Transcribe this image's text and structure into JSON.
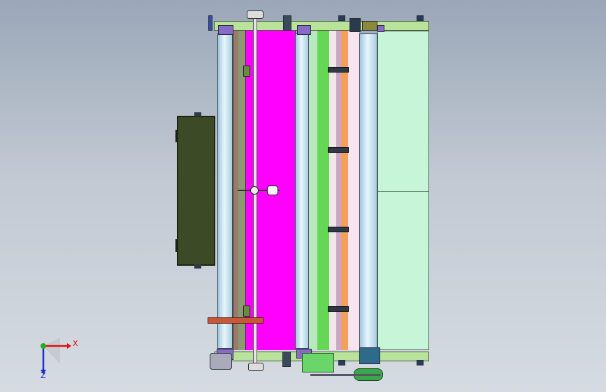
{
  "triad": {
    "x_label": "X",
    "z_label": "Z"
  },
  "colors": {
    "background_top": "#9aa7b8",
    "panel_dark": "#3c4a26",
    "magenta_sheet": "#ff00ff",
    "light_green_sheet": "#c7f5d8",
    "green_strip": "#66d655",
    "orange_strip": "#f4a05a",
    "roller_blue": "#cfe8f5"
  }
}
